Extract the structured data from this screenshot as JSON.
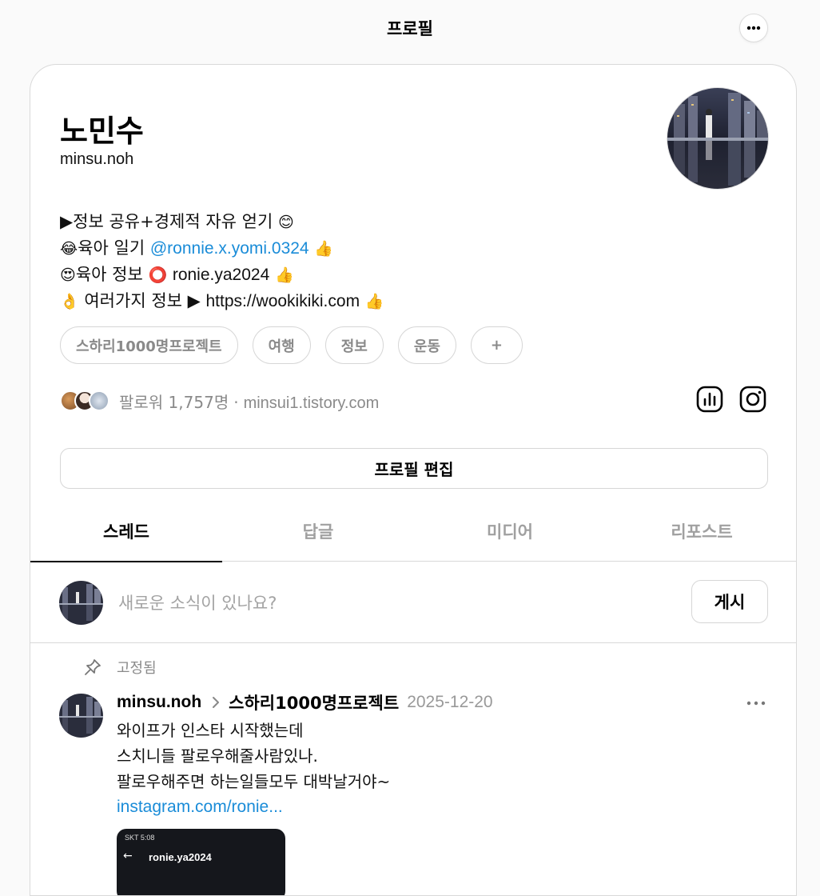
{
  "header": {
    "title": "프로필"
  },
  "profile": {
    "name": "노민수",
    "username": "minsu.noh",
    "bio": {
      "line1": {
        "lead": "▶",
        "text": "정보 공유+경제적 자유 얻기",
        "emoji": "😊"
      },
      "line2": {
        "emoji": "😂",
        "text": "육아 일기",
        "link": "@ronnie.x.yomi.0324",
        "end_emoji": "👍"
      },
      "line3": {
        "emoji": "😍",
        "text": "육아 정보",
        "mid_emoji": "⭕",
        "handle": "ronie.ya2024",
        "end_emoji": "👍"
      },
      "line4": {
        "emoji": "👌",
        "text": "여러가지 정보",
        "arrow": "▶",
        "url": "https://wookikiki.com",
        "end_emoji": "👍"
      }
    },
    "tags": [
      "스하리1000명프로젝트",
      "여행",
      "정보",
      "운동",
      "+"
    ],
    "followers_label": "팔로워 1,757명",
    "separator": "·",
    "website": "minsui1.tistory.com",
    "edit_button": "프로필 편집"
  },
  "tabs": [
    "스레드",
    "답글",
    "미디어",
    "리포스트"
  ],
  "active_tab": "스레드",
  "composer": {
    "placeholder": "새로운 소식이 있나요?",
    "post_button": "게시"
  },
  "post": {
    "pinned_label": "고정됨",
    "username": "minsu.noh",
    "topic": "스하리1000명프로젝트",
    "date": "2025-12-20",
    "lines": [
      "와이프가 인스타 시작했는데",
      "스치니들 팔로우해줄사람있나.",
      "팔로우해주면 하는일들모두 대박날거야~"
    ],
    "link": "instagram.com/ronie...",
    "screenshot": {
      "status": "SKT 5:08",
      "title": "ronie.ya2024"
    }
  },
  "colors": {
    "link": "#1a8cd8",
    "muted": "#8a8a8a",
    "border": "#d9d9d9"
  }
}
